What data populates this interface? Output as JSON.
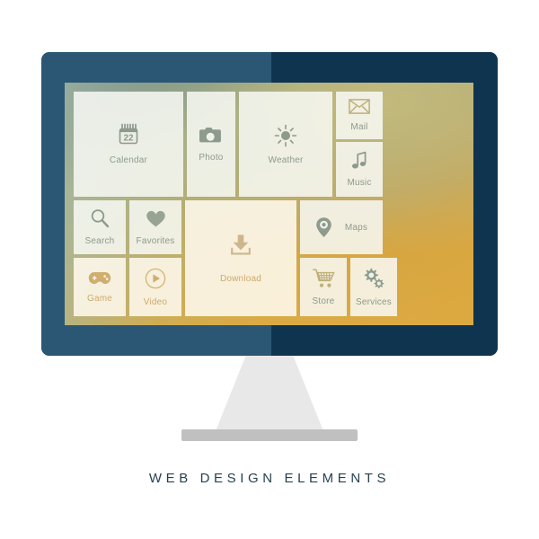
{
  "caption": "WEB  DESIGN  ELEMENTS",
  "colors": {
    "bezel_left": "#2b5775",
    "bezel_right": "#0f3450",
    "screen_top": "#a6ac76",
    "screen_bottom": "#dda83e",
    "tile_cool": "#f8f9f4",
    "tile_warm": "#fdf7ea",
    "label_cool": "#8d9a8c",
    "label_warm": "#cbab6c",
    "caption": "#27424f",
    "stand_neck": "#e8e8e8",
    "stand_base": "#c0c0c0"
  },
  "screen": {
    "tiles": [
      {
        "id": "calendar",
        "label": "Calendar",
        "icon": "calendar-icon",
        "tone": "cool",
        "layout": "stack",
        "badge": "22"
      },
      {
        "id": "photo",
        "label": "Photo",
        "icon": "camera-icon",
        "tone": "cool",
        "layout": "stack"
      },
      {
        "id": "weather",
        "label": "Weather",
        "icon": "sun-icon",
        "tone": "cool",
        "layout": "stack"
      },
      {
        "id": "mail",
        "label": "Mail",
        "icon": "envelope-icon",
        "tone": "cool",
        "layout": "stack"
      },
      {
        "id": "music",
        "label": "Music",
        "icon": "music-note-icon",
        "tone": "cool",
        "layout": "stack"
      },
      {
        "id": "search",
        "label": "Search",
        "icon": "magnifier-icon",
        "tone": "cool",
        "layout": "stack"
      },
      {
        "id": "favorites",
        "label": "Favorites",
        "icon": "heart-icon",
        "tone": "cool",
        "layout": "stack"
      },
      {
        "id": "download",
        "label": "Download",
        "icon": "download-icon",
        "tone": "warm",
        "layout": "stack"
      },
      {
        "id": "maps",
        "label": "Maps",
        "icon": "map-pin-icon",
        "tone": "cool",
        "layout": "row"
      },
      {
        "id": "game",
        "label": "Game",
        "icon": "gamepad-icon",
        "tone": "warm",
        "layout": "stack"
      },
      {
        "id": "video",
        "label": "Video",
        "icon": "play-circle-icon",
        "tone": "warm",
        "layout": "stack"
      },
      {
        "id": "store",
        "label": "Store",
        "icon": "cart-icon",
        "tone": "cool",
        "layout": "stack"
      },
      {
        "id": "services",
        "label": "Services",
        "icon": "gears-icon",
        "tone": "cool",
        "layout": "stack"
      }
    ]
  }
}
